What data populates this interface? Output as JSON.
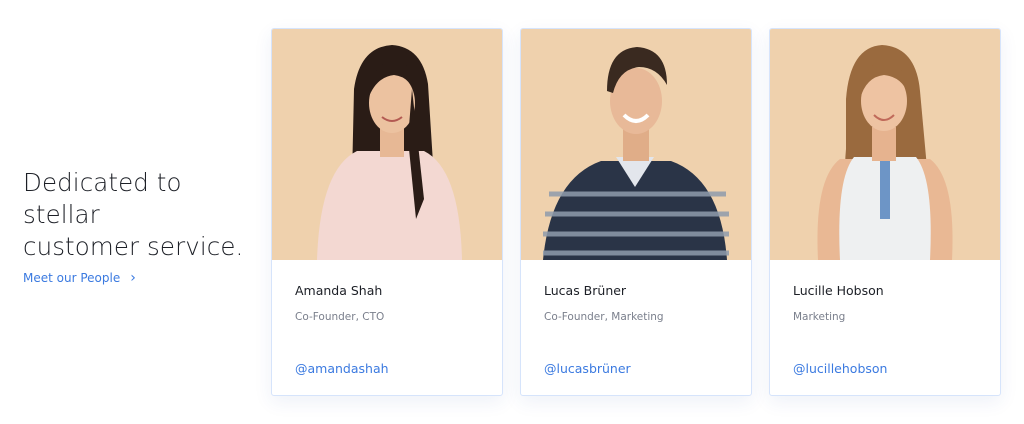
{
  "intro": {
    "headline_line1": "Dedicated to stellar",
    "headline_line2": "customer service.",
    "cta_label": "Meet our People",
    "cta_chevron": "›"
  },
  "people": [
    {
      "name": "Amanda Shah",
      "role": "Co-Founder, CTO",
      "handle": "@amandashah"
    },
    {
      "name": "Lucas Brüner",
      "role": "Co-Founder, Marketing",
      "handle": "@lucasbrüner"
    },
    {
      "name": "Lucille Hobson",
      "role": "Marketing",
      "handle": "@lucillehobson"
    }
  ],
  "colors": {
    "accent": "#3b7ae0",
    "photo_background": "#efd1ad",
    "card_border": "#d6e4fb"
  }
}
